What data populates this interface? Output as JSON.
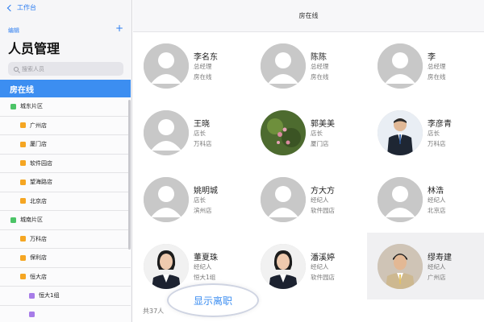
{
  "sidebar": {
    "back_label": "工作台",
    "edit_label": "编辑",
    "add_label": "+",
    "title": "人员管理",
    "search_placeholder": "搜索人员",
    "section_label": "房在线",
    "items": [
      {
        "label": "城东片区",
        "level": 1,
        "color": "green"
      },
      {
        "label": "广州店",
        "level": 2,
        "color": "orange"
      },
      {
        "label": "厦门店",
        "level": 2,
        "color": "orange"
      },
      {
        "label": "软件园店",
        "level": 2,
        "color": "orange"
      },
      {
        "label": "望海路店",
        "level": 2,
        "color": "orange"
      },
      {
        "label": "北京店",
        "level": 2,
        "color": "orange"
      },
      {
        "label": "城南片区",
        "level": 1,
        "color": "green"
      },
      {
        "label": "万科店",
        "level": 2,
        "color": "orange"
      },
      {
        "label": "保利店",
        "level": 2,
        "color": "orange"
      },
      {
        "label": "恒大店",
        "level": 2,
        "color": "orange"
      },
      {
        "label": "恒大1组",
        "level": 3,
        "color": "purple"
      },
      {
        "label": "",
        "level": 3,
        "color": "purple"
      }
    ]
  },
  "main": {
    "title": "房在线",
    "total_label": "共37人",
    "show_resigned_label": "显示离职",
    "people": [
      {
        "name": "李名东",
        "role": "总经理",
        "store": "房在线",
        "avatar": "placeholder"
      },
      {
        "name": "陈陈",
        "role": "总经理",
        "store": "房在线",
        "avatar": "placeholder"
      },
      {
        "name": "李",
        "role": "总经理",
        "store": "房在线",
        "avatar": "placeholder"
      },
      {
        "name": "王晓",
        "role": "店长",
        "store": "万科店",
        "avatar": "placeholder"
      },
      {
        "name": "郭美美",
        "role": "店长",
        "store": "厦门店",
        "avatar": "flower-photo"
      },
      {
        "name": "李彦青",
        "role": "店长",
        "store": "万科店",
        "avatar": "man-in-suit-photo"
      },
      {
        "name": "姚明城",
        "role": "店长",
        "store": "滨州店",
        "avatar": "placeholder"
      },
      {
        "name": "方大方",
        "role": "经纪人",
        "store": "软件园店",
        "avatar": "placeholder"
      },
      {
        "name": "林浩",
        "role": "经纪人",
        "store": "北京店",
        "avatar": "placeholder"
      },
      {
        "name": "董夏珠",
        "role": "经纪人",
        "store": "恒大1组",
        "avatar": "woman-photo"
      },
      {
        "name": "潘溪婷",
        "role": "经纪人",
        "store": "软件园店",
        "avatar": "woman-photo"
      },
      {
        "name": "缪寿建",
        "role": "经纪人",
        "store": "广州店",
        "avatar": "man-photo"
      }
    ]
  },
  "colors": {
    "accent": "#3c8ef1",
    "link": "#2b7cf0",
    "sidebar_bg": "#f6f6f8"
  }
}
